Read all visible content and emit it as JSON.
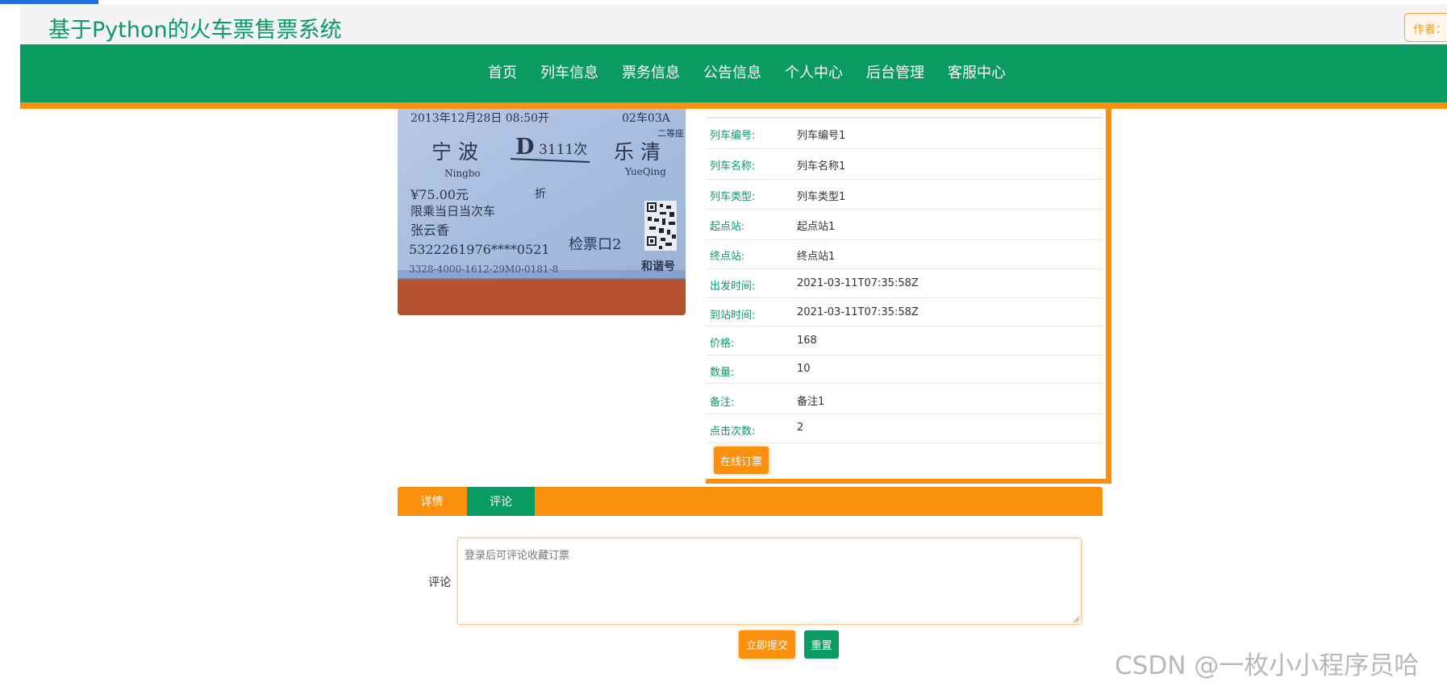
{
  "header": {
    "site_title": "基于Python的火车票售票系统",
    "author_label": "作者：adm"
  },
  "nav": {
    "items": [
      "首页",
      "列车信息",
      "票务信息",
      "公告信息",
      "个人中心",
      "后台管理",
      "客服中心"
    ]
  },
  "ticket_image": {
    "date_line": "2013年12月28日 08:50开",
    "car_seat": "02车03A",
    "seat_class": "二等座",
    "from_station": "宁 波",
    "train_no_prefix": "D",
    "train_no": "3111次",
    "to_station": "乐 清",
    "from_pinyin": "Ningbo",
    "to_pinyin": "YueQing",
    "price": "¥75.00元",
    "discount": "折",
    "note": "限乘当日当次车",
    "passenger": "张云香",
    "id_number": "5322261976****0521",
    "gate": "检票口2",
    "serial": "3328-4000-1612-29M0-0181-8",
    "slogan": "和谐号"
  },
  "details": [
    {
      "label": "列车编号:",
      "value": "列车编号1"
    },
    {
      "label": "列车名称:",
      "value": "列车名称1"
    },
    {
      "label": "列车类型:",
      "value": "列车类型1"
    },
    {
      "label": "起点站:",
      "value": "起点站1"
    },
    {
      "label": "终点站:",
      "value": "终点站1"
    },
    {
      "label": "出发时间:",
      "value": "2021-03-11T07:35:58Z"
    },
    {
      "label": "到站时间:",
      "value": "2021-03-11T07:35:58Z"
    },
    {
      "label": "价格:",
      "value": "168"
    },
    {
      "label": "数量:",
      "value": "10"
    },
    {
      "label": "备注:",
      "value": "备注1"
    },
    {
      "label": "点击次数:",
      "value": "2"
    }
  ],
  "order_button": "在线订票",
  "tabs": {
    "detail": "详情",
    "comment": "评论"
  },
  "comment_form": {
    "label": "评论",
    "placeholder": "登录后可评论收藏订票",
    "submit": "立即提交",
    "reset": "重置"
  },
  "watermark": "CSDN @一枚小小程序员哈",
  "colors": {
    "brand_green": "#0a9a62",
    "accent_orange": "#fb8f0e",
    "loader_blue": "#1e6fd9"
  }
}
